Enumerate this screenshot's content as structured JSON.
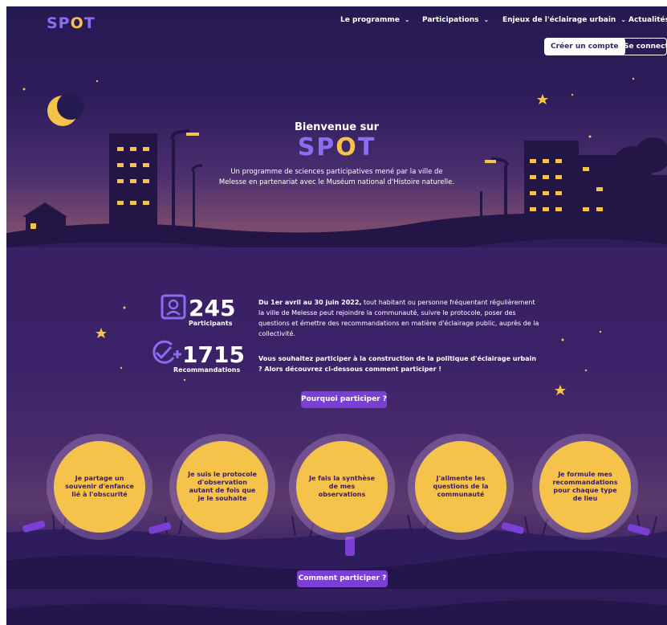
{
  "nav": {
    "logo_prefix": "SP",
    "logo_o": "O",
    "logo_suffix": "T",
    "menu": [
      {
        "label": "Le programme"
      },
      {
        "label": "Participations"
      },
      {
        "label": "Enjeux de l'éclairage urbain"
      },
      {
        "label": "Actualités"
      }
    ],
    "create_account": "Créer un compte",
    "login": "Se connecte"
  },
  "hero": {
    "welcome": "Bienvenue sur",
    "brand_prefix": "SP",
    "brand_o": "O",
    "brand_suffix": "T",
    "intro_line1": "Un programme de sciences participatives mené par la ville de",
    "intro_line2": "Melesse en partenariat avec le Muséum national d'Histoire naturelle."
  },
  "stats": [
    {
      "value": "245",
      "label": "Participants",
      "icon": "user-id-icon"
    },
    {
      "value": "1715",
      "label": "Recommandations",
      "icon": "check-plus-icon"
    }
  ],
  "info": {
    "p1_bold": "Du 1er avril au 30 juin 2022,",
    "p1_rest": " tout habitant ou personne fréquentant régulièrement la ville de Melesse peut rejoindre la communauté, suivre le protocole, poser des questions et émettre des recommandations en matière d'éclairage public, auprès de la collectivité.",
    "p2": "Vous souhaitez participer à la construction de la politique d'éclairage urbain ? Alors découvrez ci-dessous comment participer !",
    "why_button": "Pourquoi participer ?"
  },
  "steps": [
    {
      "label": "Je partage un souvenir d'enfance lié à l'obscurité"
    },
    {
      "label": "Je suis le protocole d'observation autant de fois que je le souhaite"
    },
    {
      "label": "Je fais la synthèse de mes observations"
    },
    {
      "label": "J'alimente les questions de la communauté"
    },
    {
      "label": "Je formule mes recommandations pour chaque type de lieu"
    }
  ],
  "how_button": "Comment participer ?",
  "colors": {
    "brand_purple": "#8c6cf0",
    "accent_yellow": "#f5c24a",
    "button_purple": "#7c3fd6",
    "night": "#2a1a55"
  }
}
